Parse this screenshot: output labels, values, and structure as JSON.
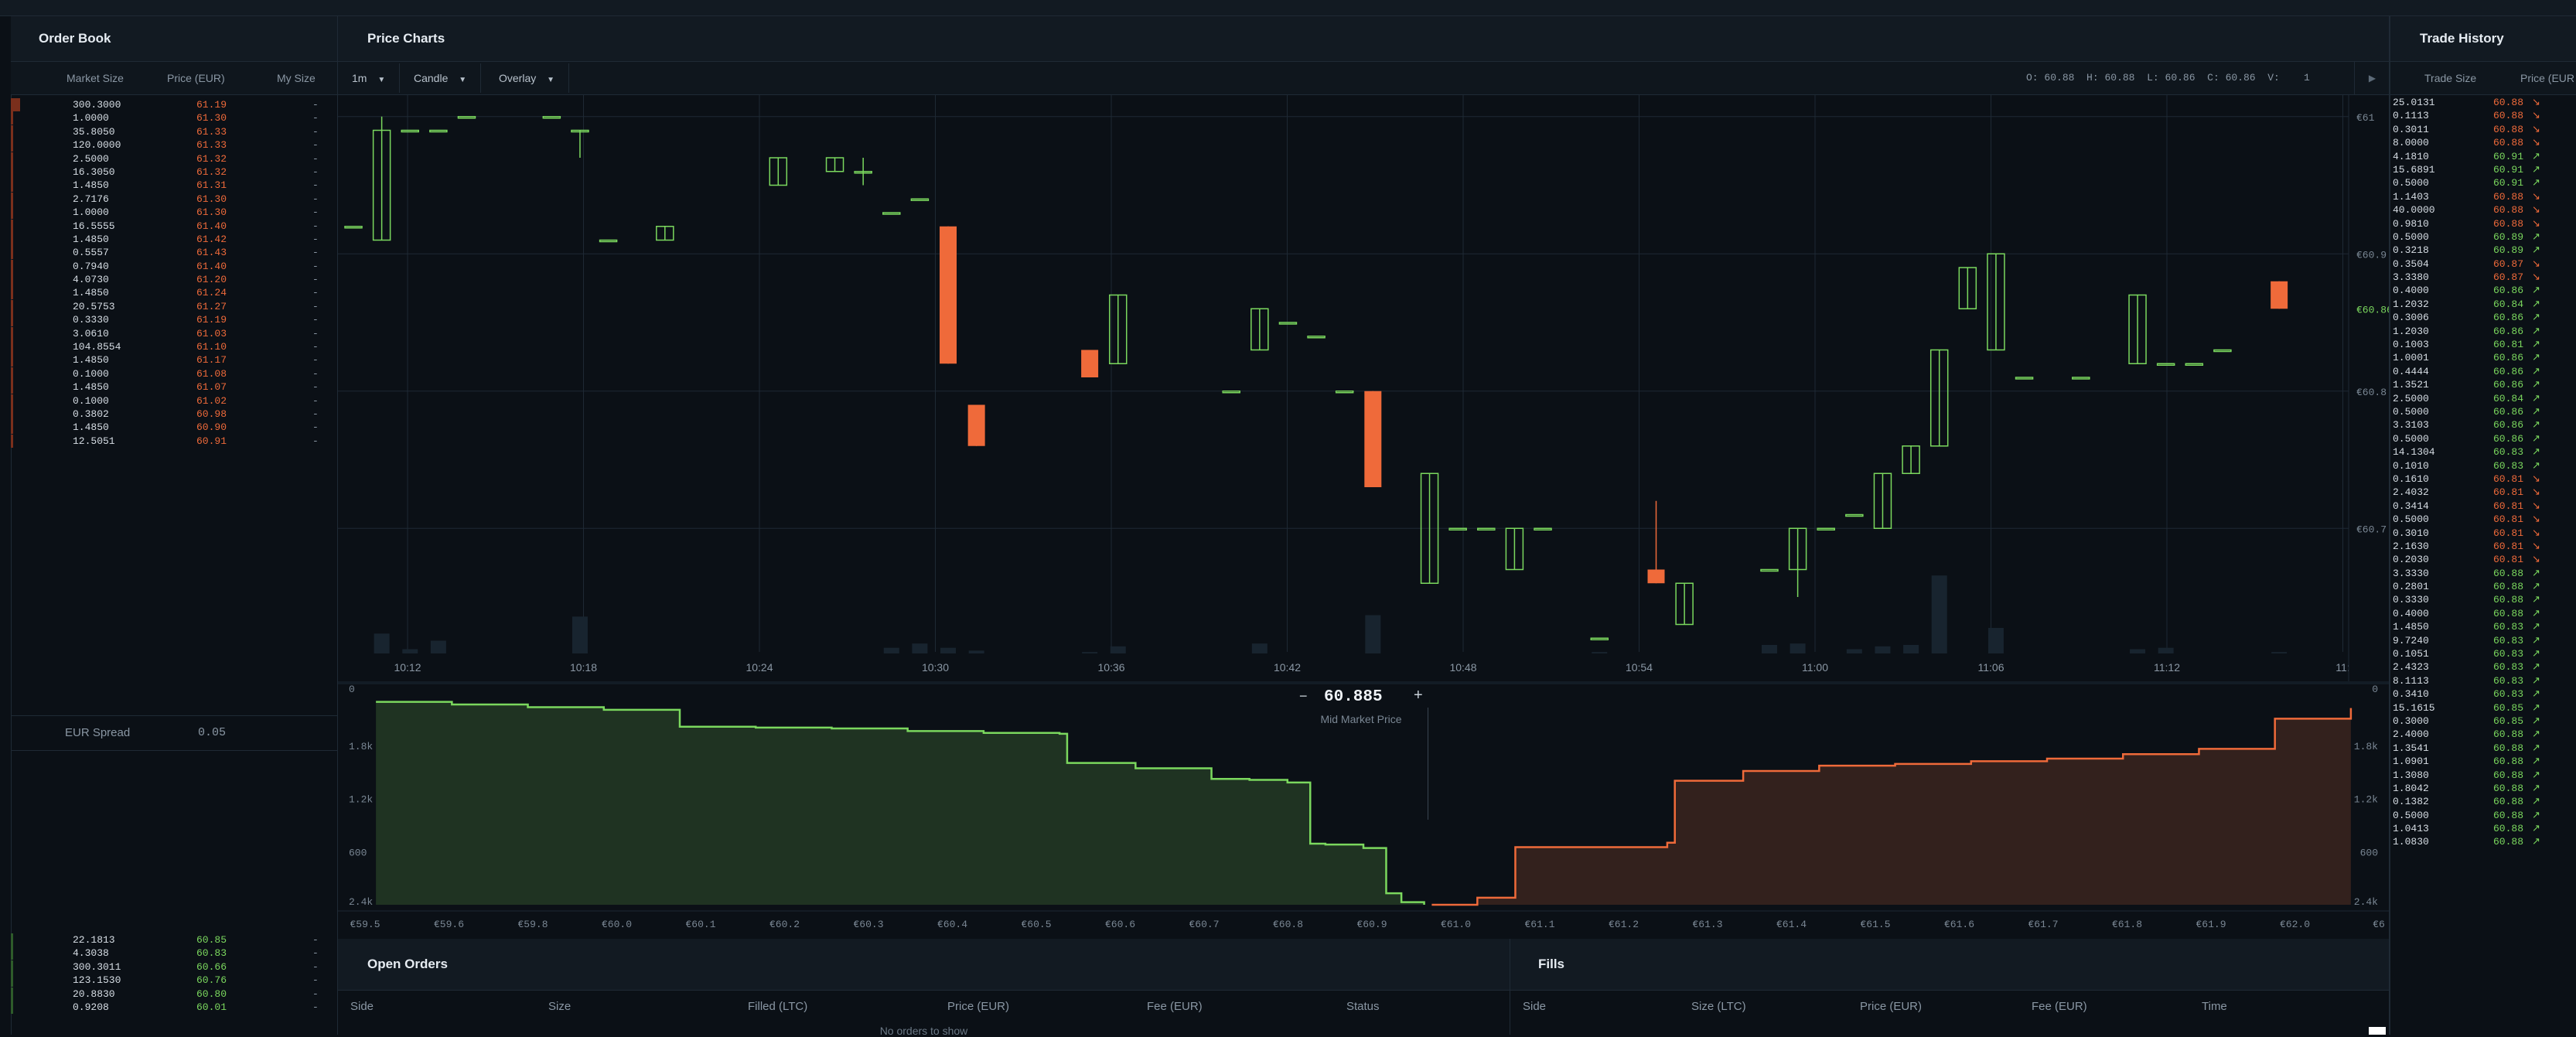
{
  "colors": {
    "buy": "#7bd85e",
    "sell": "#ef6a3a",
    "bg": "#0b1016",
    "panel": "#121a22"
  },
  "order_book": {
    "title": "Order Book",
    "headers": {
      "market_size": "Market Size",
      "price": "Price (EUR)",
      "my_size": "My Size"
    },
    "asks": [
      {
        "size": "300.3000",
        "price": "61.19",
        "my": "-"
      },
      {
        "size": "1.0000",
        "price": "61.30",
        "my": "-"
      },
      {
        "size": "35.8050",
        "price": "61.33",
        "my": "-"
      },
      {
        "size": "120.0000",
        "price": "61.33",
        "my": "-"
      },
      {
        "size": "2.5000",
        "price": "61.32",
        "my": "-"
      },
      {
        "size": "16.3050",
        "price": "61.32",
        "my": "-"
      },
      {
        "size": "1.4850",
        "price": "61.31",
        "my": "-"
      },
      {
        "size": "2.7176",
        "price": "61.30",
        "my": "-"
      },
      {
        "size": "1.0000",
        "price": "61.30",
        "my": "-"
      },
      {
        "size": "16.5555",
        "price": "61.40",
        "my": "-"
      },
      {
        "size": "1.4850",
        "price": "61.42",
        "my": "-"
      },
      {
        "size": "0.5557",
        "price": "61.43",
        "my": "-"
      },
      {
        "size": "0.7940",
        "price": "61.40",
        "my": "-"
      },
      {
        "size": "4.0730",
        "price": "61.20",
        "my": "-"
      },
      {
        "size": "1.4850",
        "price": "61.24",
        "my": "-"
      },
      {
        "size": "20.5753",
        "price": "61.27",
        "my": "-"
      },
      {
        "size": "0.3330",
        "price": "61.19",
        "my": "-"
      },
      {
        "size": "3.0610",
        "price": "61.03",
        "my": "-"
      },
      {
        "size": "104.8554",
        "price": "61.10",
        "my": "-"
      },
      {
        "size": "1.4850",
        "price": "61.17",
        "my": "-"
      },
      {
        "size": "0.1000",
        "price": "61.08",
        "my": "-"
      },
      {
        "size": "1.4850",
        "price": "61.07",
        "my": "-"
      },
      {
        "size": "0.1000",
        "price": "61.02",
        "my": "-"
      },
      {
        "size": "0.3802",
        "price": "60.98",
        "my": "-"
      },
      {
        "size": "1.4850",
        "price": "60.90",
        "my": "-"
      },
      {
        "size": "12.5051",
        "price": "60.91",
        "my": "-"
      }
    ],
    "spread_label": "EUR Spread",
    "spread_value": "0.05",
    "bids": [
      {
        "size": "22.1813",
        "price": "60.85",
        "my": "-"
      },
      {
        "size": "4.3038",
        "price": "60.83",
        "my": "-"
      },
      {
        "size": "300.3011",
        "price": "60.66",
        "my": "-"
      },
      {
        "size": "123.1530",
        "price": "60.76",
        "my": "-"
      },
      {
        "size": "20.8830",
        "price": "60.80",
        "my": "-"
      },
      {
        "size": "0.9208",
        "price": "60.01",
        "my": "-"
      }
    ]
  },
  "price_charts": {
    "title": "Price Charts",
    "interval": "1m",
    "chart_type": "Candle",
    "overlay": "Overlay",
    "ohlcv": {
      "o_label": "O:",
      "o": "60.88",
      "h_label": "H:",
      "h": "60.88",
      "l_label": "L:",
      "l": "60.86",
      "c_label": "C:",
      "c": "60.86",
      "v_label": "V:",
      "v": "1"
    },
    "play_icon": "play-icon",
    "last_price": "€60.86"
  },
  "chart_data": [
    {
      "type": "candlestick",
      "title": "",
      "y_axis_labels": [
        "€61",
        "€60.9",
        "€60.8",
        "€60.7"
      ],
      "y_ticks": [
        61.0,
        60.9,
        60.8,
        60.7
      ],
      "ylim": [
        60.61,
        61.01
      ],
      "x_tick_labels": [
        "10:12",
        "10:18",
        "10:24",
        "10:30",
        "10:36",
        "10:42",
        "10:48",
        "10:54",
        "11:00",
        "11:06",
        "11:12",
        "11:"
      ],
      "grid": true,
      "candles": [
        {
          "i": 0,
          "o": 60.92,
          "h": 60.92,
          "l": 60.92,
          "c": 60.92,
          "v": 0
        },
        {
          "i": 1,
          "o": 60.91,
          "h": 61.0,
          "l": 60.91,
          "c": 60.99,
          "v": 14
        },
        {
          "i": 2,
          "o": 60.99,
          "h": 60.99,
          "l": 60.99,
          "c": 60.99,
          "v": 3
        },
        {
          "i": 3,
          "o": 60.99,
          "h": 60.99,
          "l": 60.99,
          "c": 60.99,
          "v": 9
        },
        {
          "i": 4,
          "o": 61.0,
          "h": 61.0,
          "l": 61.0,
          "c": 61.0,
          "v": 0
        },
        {
          "i": 7,
          "o": 61.0,
          "h": 61.0,
          "l": 61.0,
          "c": 61.0,
          "v": 0
        },
        {
          "i": 8,
          "o": 60.99,
          "h": 60.99,
          "l": 60.97,
          "c": 60.99,
          "v": 26
        },
        {
          "i": 9,
          "o": 60.91,
          "h": 60.91,
          "l": 60.91,
          "c": 60.91,
          "v": 0
        },
        {
          "i": 11,
          "o": 60.91,
          "h": 60.92,
          "l": 60.91,
          "c": 60.92,
          "v": 0
        },
        {
          "i": 15,
          "o": 60.95,
          "h": 60.97,
          "l": 60.95,
          "c": 60.97,
          "v": 0
        },
        {
          "i": 17,
          "o": 60.96,
          "h": 60.97,
          "l": 60.96,
          "c": 60.97,
          "v": 0
        },
        {
          "i": 18,
          "o": 60.96,
          "h": 60.97,
          "l": 60.95,
          "c": 60.96,
          "v": 0
        },
        {
          "i": 19,
          "o": 60.93,
          "h": 60.93,
          "l": 60.93,
          "c": 60.93,
          "v": 4
        },
        {
          "i": 20,
          "o": 60.94,
          "h": 60.94,
          "l": 60.94,
          "c": 60.94,
          "v": 7
        },
        {
          "i": 21,
          "o": 60.92,
          "h": 60.92,
          "l": 60.82,
          "c": 60.82,
          "v": 4
        },
        {
          "i": 22,
          "o": 60.79,
          "h": 60.79,
          "l": 60.76,
          "c": 60.76,
          "v": 2
        },
        {
          "i": 26,
          "o": 60.83,
          "h": 60.83,
          "l": 60.81,
          "c": 60.81,
          "v": 1
        },
        {
          "i": 27,
          "o": 60.82,
          "h": 60.87,
          "l": 60.82,
          "c": 60.87,
          "v": 5
        },
        {
          "i": 31,
          "o": 60.8,
          "h": 60.8,
          "l": 60.8,
          "c": 60.8,
          "v": 0
        },
        {
          "i": 32,
          "o": 60.83,
          "h": 60.86,
          "l": 60.83,
          "c": 60.86,
          "v": 7
        },
        {
          "i": 33,
          "o": 60.85,
          "h": 60.85,
          "l": 60.85,
          "c": 60.85,
          "v": 0
        },
        {
          "i": 34,
          "o": 60.84,
          "h": 60.84,
          "l": 60.84,
          "c": 60.84,
          "v": 0
        },
        {
          "i": 35,
          "o": 60.8,
          "h": 60.8,
          "l": 60.8,
          "c": 60.8,
          "v": 0
        },
        {
          "i": 36,
          "o": 60.8,
          "h": 60.8,
          "l": 60.73,
          "c": 60.73,
          "v": 27
        },
        {
          "i": 38,
          "o": 60.66,
          "h": 60.74,
          "l": 60.66,
          "c": 60.74,
          "v": 0
        },
        {
          "i": 39,
          "o": 60.7,
          "h": 60.7,
          "l": 60.7,
          "c": 60.7,
          "v": 0
        },
        {
          "i": 40,
          "o": 60.7,
          "h": 60.7,
          "l": 60.7,
          "c": 60.7,
          "v": 0
        },
        {
          "i": 41,
          "o": 60.67,
          "h": 60.7,
          "l": 60.67,
          "c": 60.7,
          "v": 0
        },
        {
          "i": 42,
          "o": 60.7,
          "h": 60.7,
          "l": 60.7,
          "c": 60.7,
          "v": 0
        },
        {
          "i": 44,
          "o": 60.62,
          "h": 60.62,
          "l": 60.62,
          "c": 60.62,
          "v": 1
        },
        {
          "i": 46,
          "o": 60.67,
          "h": 60.72,
          "l": 60.66,
          "c": 60.66,
          "v": 0
        },
        {
          "i": 47,
          "o": 60.63,
          "h": 60.66,
          "l": 60.63,
          "c": 60.66,
          "v": 0
        },
        {
          "i": 50,
          "o": 60.67,
          "h": 60.67,
          "l": 60.67,
          "c": 60.67,
          "v": 6
        },
        {
          "i": 51,
          "o": 60.67,
          "h": 60.7,
          "l": 60.65,
          "c": 60.7,
          "v": 7
        },
        {
          "i": 52,
          "o": 60.7,
          "h": 60.7,
          "l": 60.7,
          "c": 60.7,
          "v": 0
        },
        {
          "i": 53,
          "o": 60.71,
          "h": 60.71,
          "l": 60.71,
          "c": 60.71,
          "v": 3
        },
        {
          "i": 54,
          "o": 60.7,
          "h": 60.74,
          "l": 60.7,
          "c": 60.74,
          "v": 5
        },
        {
          "i": 55,
          "o": 60.74,
          "h": 60.76,
          "l": 60.74,
          "c": 60.76,
          "v": 6
        },
        {
          "i": 56,
          "o": 60.76,
          "h": 60.83,
          "l": 60.76,
          "c": 60.83,
          "v": 55
        },
        {
          "i": 57,
          "o": 60.86,
          "h": 60.89,
          "l": 60.86,
          "c": 60.89,
          "v": 0
        },
        {
          "i": 58,
          "o": 60.83,
          "h": 60.9,
          "l": 60.83,
          "c": 60.9,
          "v": 18
        },
        {
          "i": 59,
          "o": 60.81,
          "h": 60.81,
          "l": 60.81,
          "c": 60.81,
          "v": 0
        },
        {
          "i": 61,
          "o": 60.81,
          "h": 60.81,
          "l": 60.81,
          "c": 60.81,
          "v": 0
        },
        {
          "i": 63,
          "o": 60.82,
          "h": 60.87,
          "l": 60.82,
          "c": 60.87,
          "v": 3
        },
        {
          "i": 64,
          "o": 60.82,
          "h": 60.82,
          "l": 60.82,
          "c": 60.82,
          "v": 4
        },
        {
          "i": 65,
          "o": 60.82,
          "h": 60.82,
          "l": 60.82,
          "c": 60.82,
          "v": 0
        },
        {
          "i": 66,
          "o": 60.83,
          "h": 60.83,
          "l": 60.83,
          "c": 60.83,
          "v": 0
        },
        {
          "i": 68,
          "o": 60.88,
          "h": 60.88,
          "l": 60.86,
          "c": 60.86,
          "v": 1
        }
      ]
    },
    {
      "type": "area",
      "title": "",
      "center_price": "60.885",
      "center_label": "Mid Market Price",
      "y_axis_labels": [
        "0",
        "600",
        "1.2k",
        "1.8k",
        "2.4k"
      ],
      "x_tick_labels": [
        "€59.5",
        "€59.6",
        "€59.8",
        "€60.0",
        "€60.1",
        "€60.2",
        "€60.3",
        "€60.4",
        "€60.5",
        "€60.6",
        "€60.7",
        "€60.8",
        "€60.9",
        "€61.0",
        "€61.1",
        "€61.2",
        "€61.3",
        "€61.4",
        "€61.5",
        "€61.6",
        "€61.7",
        "€61.8",
        "€61.9",
        "€62.0",
        "€6"
      ],
      "series": [
        {
          "name": "bids",
          "x": [
            59.5,
            59.6,
            59.7,
            59.8,
            59.9,
            60.0,
            60.1,
            60.2,
            60.3,
            60.4,
            60.41,
            60.5,
            60.6,
            60.65,
            60.7,
            60.73,
            60.75,
            60.8,
            60.83,
            60.85,
            60.88
          ],
          "y": [
            2290,
            2260,
            2230,
            2200,
            2010,
            2000,
            1990,
            1960,
            1940,
            1930,
            1600,
            1540,
            1420,
            1410,
            1380,
            690,
            680,
            640,
            130,
            30,
            0
          ]
        },
        {
          "name": "asks",
          "x": [
            60.89,
            60.9,
            60.95,
            61.0,
            61.2,
            61.21,
            61.3,
            61.4,
            61.5,
            61.6,
            61.7,
            61.8,
            61.9,
            62.0,
            62.1
          ],
          "y": [
            0,
            0,
            80,
            650,
            700,
            1400,
            1510,
            1570,
            1590,
            1620,
            1650,
            1700,
            1760,
            2100,
            2220
          ]
        }
      ]
    }
  ],
  "open_orders": {
    "title": "Open Orders",
    "headers": [
      "Side",
      "Size",
      "Filled (LTC)",
      "Price (EUR)",
      "Fee (EUR)",
      "Status"
    ],
    "empty": "No orders to show"
  },
  "fills": {
    "title": "Fills",
    "headers": [
      "Side",
      "Size (LTC)",
      "Price (EUR)",
      "Fee (EUR)",
      "Time"
    ]
  },
  "trade_history": {
    "title": "Trade History",
    "headers": {
      "size": "Trade Size",
      "price": "Price (EUR"
    },
    "rows": [
      {
        "size": "25.0131",
        "price": "60.88",
        "side": "sell"
      },
      {
        "size": "0.1113",
        "price": "60.88",
        "side": "sell"
      },
      {
        "size": "0.3011",
        "price": "60.88",
        "side": "sell"
      },
      {
        "size": "8.0000",
        "price": "60.88",
        "side": "sell"
      },
      {
        "size": "4.1810",
        "price": "60.91",
        "side": "buy"
      },
      {
        "size": "15.6891",
        "price": "60.91",
        "side": "buy"
      },
      {
        "size": "0.5000",
        "price": "60.91",
        "side": "buy"
      },
      {
        "size": "1.1403",
        "price": "60.88",
        "side": "sell"
      },
      {
        "size": "40.0000",
        "price": "60.88",
        "side": "sell"
      },
      {
        "size": "0.9810",
        "price": "60.88",
        "side": "sell"
      },
      {
        "size": "0.5000",
        "price": "60.89",
        "side": "buy"
      },
      {
        "size": "0.3218",
        "price": "60.89",
        "side": "buy"
      },
      {
        "size": "0.3504",
        "price": "60.87",
        "side": "sell"
      },
      {
        "size": "3.3380",
        "price": "60.87",
        "side": "sell"
      },
      {
        "size": "0.4000",
        "price": "60.86",
        "side": "buy"
      },
      {
        "size": "1.2032",
        "price": "60.84",
        "side": "buy"
      },
      {
        "size": "0.3006",
        "price": "60.86",
        "side": "buy"
      },
      {
        "size": "1.2030",
        "price": "60.86",
        "side": "buy"
      },
      {
        "size": "0.1003",
        "price": "60.81",
        "side": "buy"
      },
      {
        "size": "1.0001",
        "price": "60.86",
        "side": "buy"
      },
      {
        "size": "0.4444",
        "price": "60.86",
        "side": "buy"
      },
      {
        "size": "1.3521",
        "price": "60.86",
        "side": "buy"
      },
      {
        "size": "2.5000",
        "price": "60.84",
        "side": "buy"
      },
      {
        "size": "0.5000",
        "price": "60.86",
        "side": "buy"
      },
      {
        "size": "3.3103",
        "price": "60.86",
        "side": "buy"
      },
      {
        "size": "0.5000",
        "price": "60.86",
        "side": "buy"
      },
      {
        "size": "14.1304",
        "price": "60.83",
        "side": "buy"
      },
      {
        "size": "0.1010",
        "price": "60.83",
        "side": "buy"
      },
      {
        "size": "0.1610",
        "price": "60.81",
        "side": "sell"
      },
      {
        "size": "2.4032",
        "price": "60.81",
        "side": "sell"
      },
      {
        "size": "0.3414",
        "price": "60.81",
        "side": "sell"
      },
      {
        "size": "0.5000",
        "price": "60.81",
        "side": "sell"
      },
      {
        "size": "0.3010",
        "price": "60.81",
        "side": "sell"
      },
      {
        "size": "2.1630",
        "price": "60.81",
        "side": "sell"
      },
      {
        "size": "0.2030",
        "price": "60.81",
        "side": "sell"
      },
      {
        "size": "3.3330",
        "price": "60.88",
        "side": "buy"
      },
      {
        "size": "0.2801",
        "price": "60.88",
        "side": "buy"
      },
      {
        "size": "0.3330",
        "price": "60.88",
        "side": "buy"
      },
      {
        "size": "0.4000",
        "price": "60.88",
        "side": "buy"
      },
      {
        "size": "1.4850",
        "price": "60.83",
        "side": "buy"
      },
      {
        "size": "9.7240",
        "price": "60.83",
        "side": "buy"
      },
      {
        "size": "0.1051",
        "price": "60.83",
        "side": "buy"
      },
      {
        "size": "2.4323",
        "price": "60.83",
        "side": "buy"
      },
      {
        "size": "8.1113",
        "price": "60.83",
        "side": "buy"
      },
      {
        "size": "0.3410",
        "price": "60.83",
        "side": "buy"
      },
      {
        "size": "15.1615",
        "price": "60.85",
        "side": "buy"
      },
      {
        "size": "0.3000",
        "price": "60.85",
        "side": "buy"
      },
      {
        "size": "2.4000",
        "price": "60.88",
        "side": "buy"
      },
      {
        "size": "1.3541",
        "price": "60.88",
        "side": "buy"
      },
      {
        "size": "1.0901",
        "price": "60.88",
        "side": "buy"
      },
      {
        "size": "1.3080",
        "price": "60.88",
        "side": "buy"
      },
      {
        "size": "1.8042",
        "price": "60.88",
        "side": "buy"
      },
      {
        "size": "0.1382",
        "price": "60.88",
        "side": "buy"
      },
      {
        "size": "0.5000",
        "price": "60.88",
        "side": "buy"
      },
      {
        "size": "1.0413",
        "price": "60.88",
        "side": "buy"
      },
      {
        "size": "1.0830",
        "price": "60.88",
        "side": "buy"
      }
    ]
  }
}
